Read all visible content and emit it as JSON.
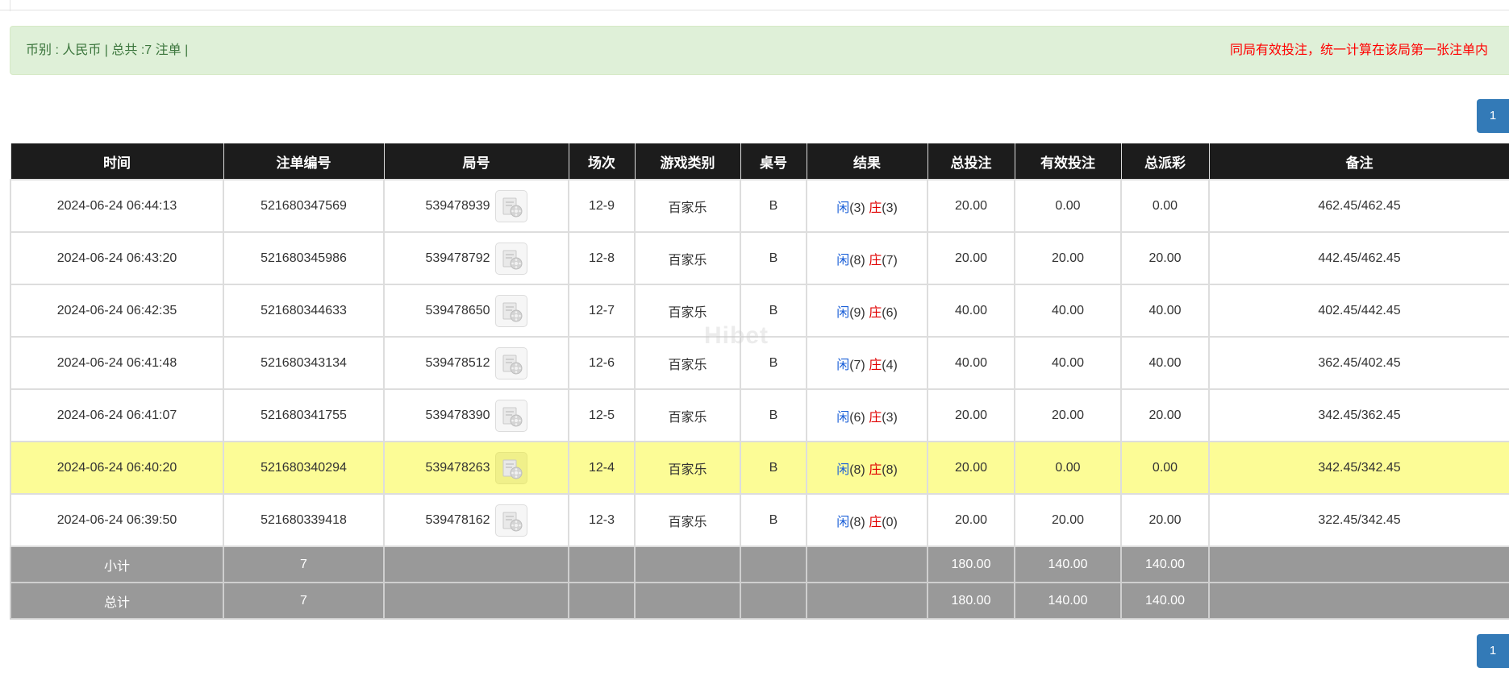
{
  "info": {
    "left": "币别 : 人民币 | 总共 :7 注单 |",
    "right": "同局有效投注，统一计算在该局第一张注单内"
  },
  "pager": {
    "top_page": "1",
    "bottom_page": "1"
  },
  "watermark": "Hibet",
  "table": {
    "headers": [
      "时间",
      "注单编号",
      "局号",
      "场次",
      "游戏类别",
      "桌号",
      "结果",
      "总投注",
      "有效投注",
      "总派彩",
      "备注"
    ],
    "rows": [
      {
        "time": "2024-06-24 06:44:13",
        "bet_no": "521680347569",
        "round": "539478939",
        "session": "12-9",
        "game": "百家乐",
        "table": "B",
        "player": "闲",
        "player_score": "(3)",
        "banker": "庄",
        "banker_score": "(3)",
        "total": "20.00",
        "valid": "0.00",
        "payout": "0.00",
        "note": "462.45/462.45"
      },
      {
        "time": "2024-06-24 06:43:20",
        "bet_no": "521680345986",
        "round": "539478792",
        "session": "12-8",
        "game": "百家乐",
        "table": "B",
        "player": "闲",
        "player_score": "(8)",
        "banker": "庄",
        "banker_score": "(7)",
        "total": "20.00",
        "valid": "20.00",
        "payout": "20.00",
        "note": "442.45/462.45"
      },
      {
        "time": "2024-06-24 06:42:35",
        "bet_no": "521680344633",
        "round": "539478650",
        "session": "12-7",
        "game": "百家乐",
        "table": "B",
        "player": "闲",
        "player_score": "(9)",
        "banker": "庄",
        "banker_score": "(6)",
        "total": "40.00",
        "valid": "40.00",
        "payout": "40.00",
        "note": "402.45/442.45"
      },
      {
        "time": "2024-06-24 06:41:48",
        "bet_no": "521680343134",
        "round": "539478512",
        "session": "12-6",
        "game": "百家乐",
        "table": "B",
        "player": "闲",
        "player_score": "(7)",
        "banker": "庄",
        "banker_score": "(4)",
        "total": "40.00",
        "valid": "40.00",
        "payout": "40.00",
        "note": "362.45/402.45"
      },
      {
        "time": "2024-06-24 06:41:07",
        "bet_no": "521680341755",
        "round": "539478390",
        "session": "12-5",
        "game": "百家乐",
        "table": "B",
        "player": "闲",
        "player_score": "(6)",
        "banker": "庄",
        "banker_score": "(3)",
        "total": "20.00",
        "valid": "20.00",
        "payout": "20.00",
        "note": "342.45/362.45"
      },
      {
        "time": "2024-06-24 06:40:20",
        "bet_no": "521680340294",
        "round": "539478263",
        "session": "12-4",
        "game": "百家乐",
        "table": "B",
        "player": "闲",
        "player_score": "(8)",
        "banker": "庄",
        "banker_score": "(8)",
        "total": "20.00",
        "valid": "0.00",
        "payout": "0.00",
        "note": "342.45/342.45"
      },
      {
        "time": "2024-06-24 06:39:50",
        "bet_no": "521680339418",
        "round": "539478162",
        "session": "12-3",
        "game": "百家乐",
        "table": "B",
        "player": "闲",
        "player_score": "(8)",
        "banker": "庄",
        "banker_score": "(0)",
        "total": "20.00",
        "valid": "20.00",
        "payout": "20.00",
        "note": "322.45/342.45"
      }
    ],
    "subtotal": {
      "label": "小计",
      "count": "7",
      "total": "180.00",
      "valid": "140.00",
      "payout": "140.00"
    },
    "grandtotal": {
      "label": "总计",
      "count": "7",
      "total": "180.00",
      "valid": "140.00",
      "payout": "140.00"
    }
  },
  "icons": {
    "replay": "video-replay-icon"
  },
  "colors": {
    "header_bg": "#1c1c1c",
    "highlight_row": "#fcfc96",
    "summary_bg": "#999999",
    "player": "#1a5fd8",
    "banker": "#e00000",
    "notice_bg": "#dff0d8",
    "notice_text": "#3c763d",
    "warning_text": "#ff0000",
    "pager": "#337ab7"
  }
}
